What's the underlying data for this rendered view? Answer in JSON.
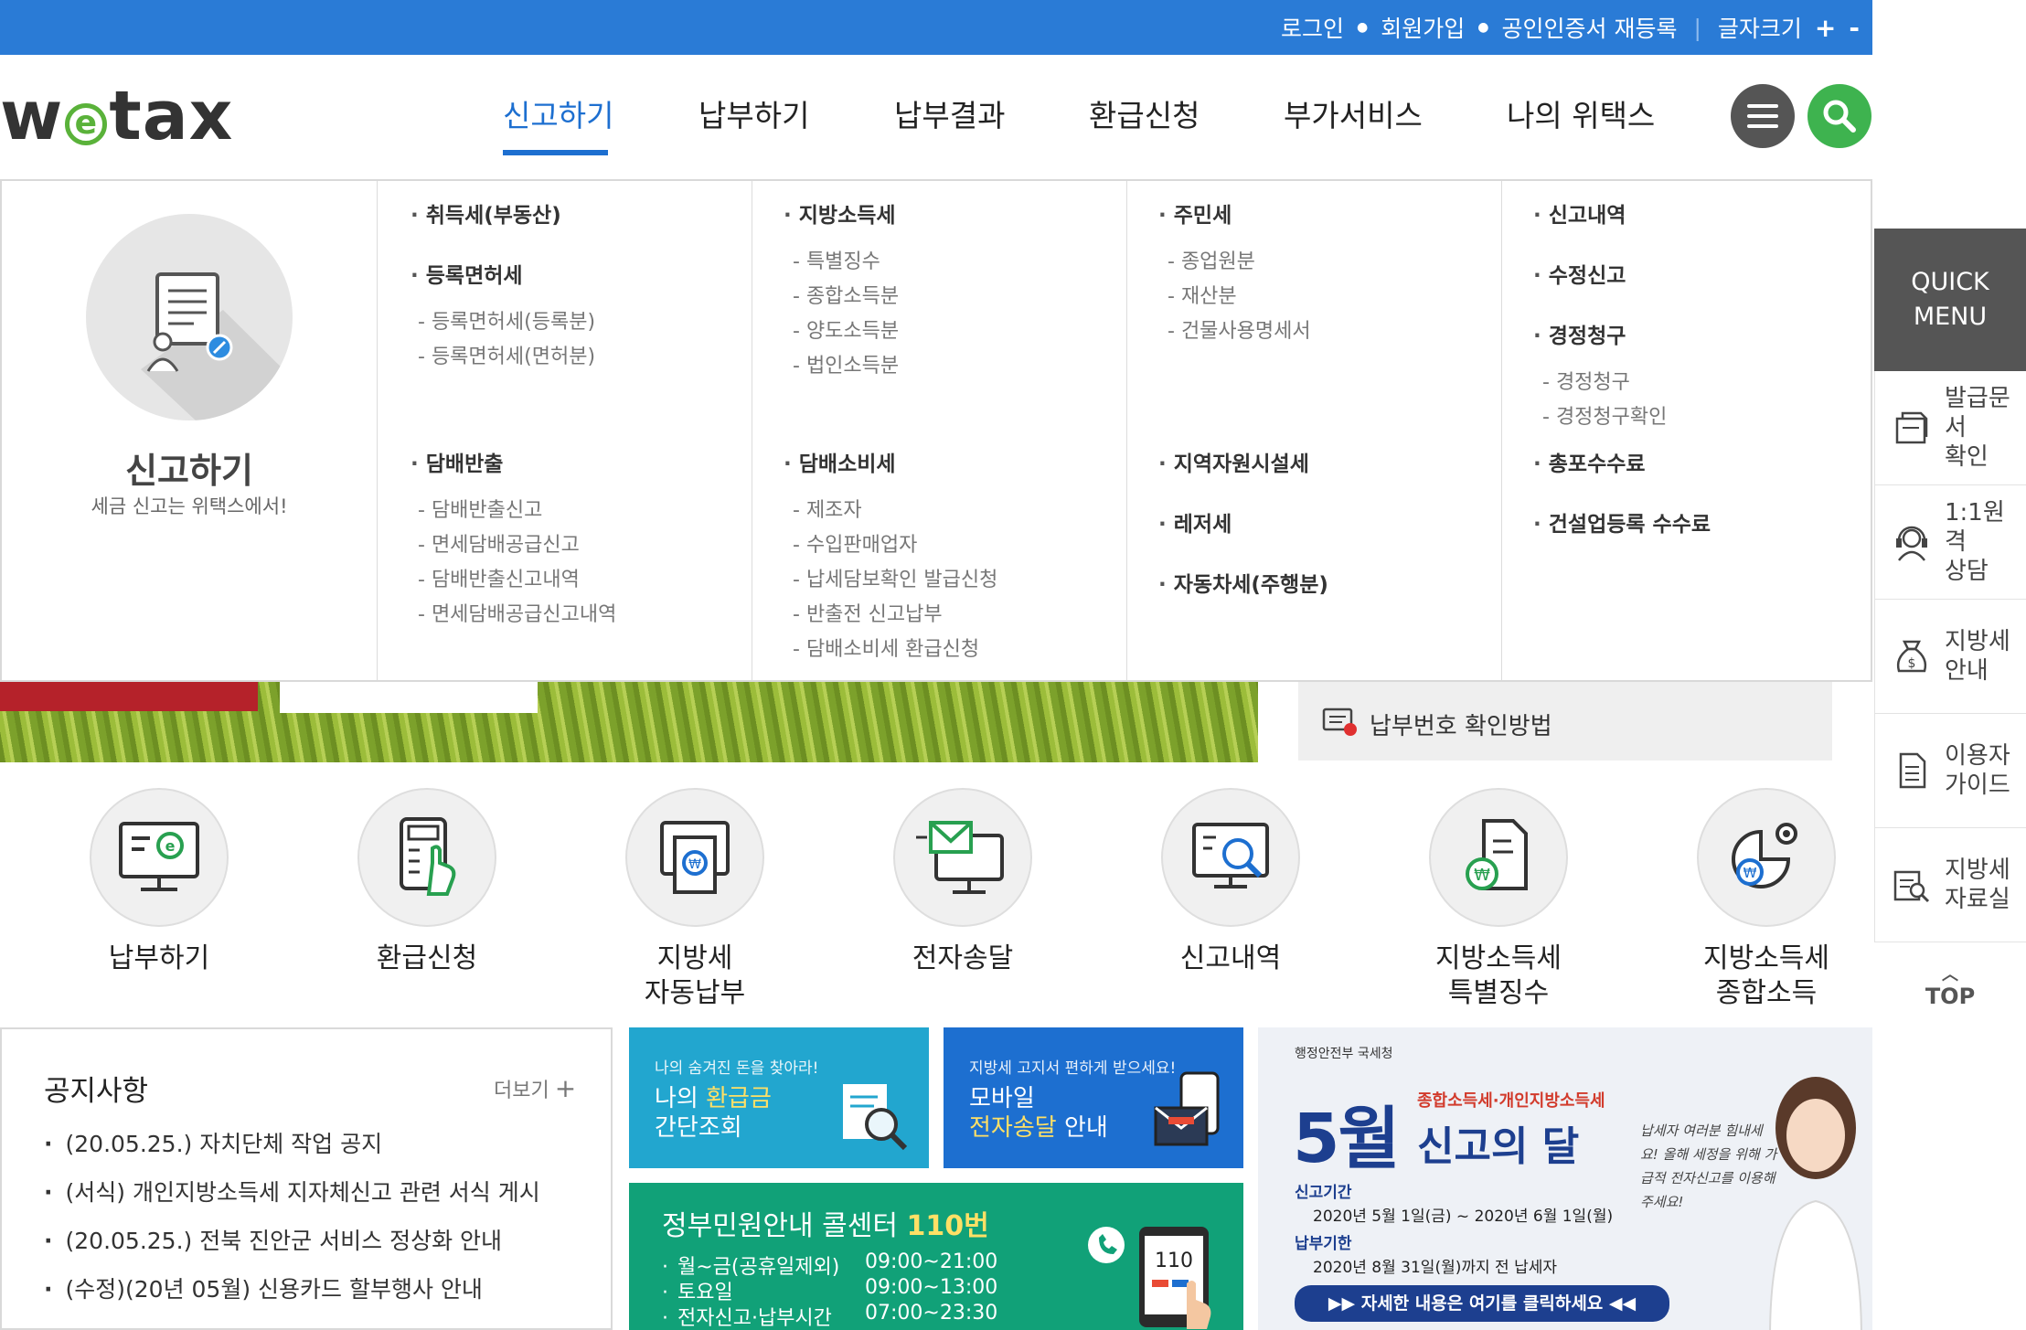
{
  "topbar": {
    "links": [
      "로그인",
      "회원가입",
      "공인인증서 재등록"
    ],
    "font_size_label": "글자크기",
    "font_plus": "+",
    "font_minus": "-"
  },
  "logo": {
    "pre": "w",
    "mid": "e",
    "post": "tax"
  },
  "gnb": {
    "items": [
      "신고하기",
      "납부하기",
      "납부결과",
      "환급신청",
      "부가서비스",
      "나의 위택스"
    ],
    "active_index": 0
  },
  "mega": {
    "intro_title": "신고하기",
    "intro_sub": "세금 신고는 위택스에서!",
    "col1": {
      "h1": "취득세(부동산)",
      "h2": "등록면허세",
      "h2_items": [
        "등록면허세(등록분)",
        "등록면허세(면허분)"
      ],
      "h3": "담배반출",
      "h3_items": [
        "담배반출신고",
        "면세담배공급신고",
        "담배반출신고내역",
        "면세담배공급신고내역"
      ]
    },
    "col2": {
      "h1": "지방소득세",
      "h1_items": [
        "특별징수",
        "종합소득분",
        "양도소득분",
        "법인소득분"
      ],
      "h2": "담배소비세",
      "h2_items": [
        "제조자",
        "수입판매업자",
        "납세담보확인 발급신청",
        "반출전 신고납부",
        "담배소비세 환급신청"
      ]
    },
    "col3": {
      "h1": "주민세",
      "h1_items": [
        "종업원분",
        "재산분",
        "건물사용명세서"
      ],
      "h2": "지역자원시설세",
      "h3": "레저세",
      "h4": "자동차세(주행분)"
    },
    "col4": {
      "h1": "신고내역",
      "h2": "수정신고",
      "h3": "경정청구",
      "h3_items": [
        "경정청구",
        "경정청구확인"
      ],
      "h4": "총포수수료",
      "h5": "건설업등록 수수료"
    }
  },
  "pay_check": "납부번호 확인방법",
  "quick_menu": {
    "title_line1": "QUICK",
    "title_line2": "MENU",
    "items": [
      {
        "l1": "발급문서",
        "l2": "확인",
        "icon": "document-icon"
      },
      {
        "l1": "1:1원격",
        "l2": "상담",
        "icon": "headset-icon"
      },
      {
        "l1": "지방세",
        "l2": "안내",
        "icon": "money-bag-icon"
      },
      {
        "l1": "이용자",
        "l2": "가이드",
        "icon": "guide-icon"
      },
      {
        "l1": "지방세",
        "l2": "자료실",
        "icon": "archive-icon"
      }
    ],
    "top_label": "TOP"
  },
  "shortcuts": [
    {
      "l1": "납부하기",
      "l2": ""
    },
    {
      "l1": "환급신청",
      "l2": ""
    },
    {
      "l1": "지방세",
      "l2": "자동납부"
    },
    {
      "l1": "전자송달",
      "l2": ""
    },
    {
      "l1": "신고내역",
      "l2": ""
    },
    {
      "l1": "지방소득세",
      "l2": "특별징수"
    },
    {
      "l1": "지방소득세",
      "l2": "종합소득"
    }
  ],
  "notice": {
    "title": "공지사항",
    "more": "더보기",
    "items": [
      "(20.05.25.) 자치단체 작업 공지",
      "(서식) 개인지방소득세 지자체신고 관련 서식 게시",
      "(20.05.25.) 전북 진안군 서비스 정상화 안내",
      "(수정)(20년 05월) 신용카드 할부행사 안내"
    ]
  },
  "promo1": {
    "small": "나의 숨겨진 돈을 찾아라!",
    "line1_a": "나의 ",
    "line1_hl": "환급금",
    "line2": "간단조회"
  },
  "promo2": {
    "small": "지방세 고지서 편하게 받으세요!",
    "line1": "모바일",
    "line2_hl": "전자송달",
    "line2_b": " 안내"
  },
  "callcenter": {
    "title": "정부민원안내 콜센터 ",
    "title_hl": "110번",
    "rows": [
      {
        "k": "월~금(공휴일제외)",
        "v": "09:00~21:00"
      },
      {
        "k": "토요일",
        "v": "09:00~13:00"
      },
      {
        "k": "전자신고·납부시간",
        "v": "07:00~23:30"
      }
    ],
    "phone_number": "110"
  },
  "may_banner": {
    "gov": "행정안전부   국세청",
    "big": "5월",
    "small": "종합소득세·개인지방소득세",
    "title": "신고의 달",
    "label1": "신고기간",
    "value1": "2020년 5월 1일(금) ~ 2020년 6월 1일(월)",
    "label2": "납부기한",
    "value2": "2020년 8월 31일(월)까지 전 납세자",
    "button": "▶▶ 자세한 내용은 여기를 클릭하세요 ◀◀",
    "note": "납세자 여러분 힘내세요! 올해 세정을 위해 가급적 전자신고를 이용해 주세요!"
  }
}
